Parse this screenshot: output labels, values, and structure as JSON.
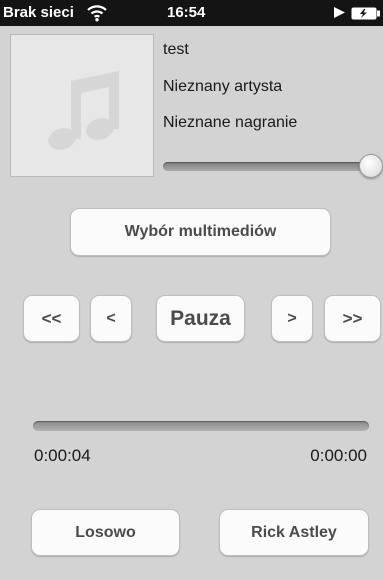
{
  "status_bar": {
    "carrier": "Brak sieci",
    "time": "16:54"
  },
  "now_playing": {
    "title": "test",
    "artist": "Nieznany artysta",
    "album": "Nieznane nagranie",
    "artwork_icon": "music-note-icon",
    "volume_level": 1.0
  },
  "buttons": {
    "media_picker": "Wybór multimediów",
    "rewind": "<<",
    "prev": "<",
    "pause": "Pauza",
    "next": ">",
    "forward": ">>",
    "shuffle": "Losowo",
    "rick_astley": "Rick Astley"
  },
  "progress": {
    "elapsed": "0:00:04",
    "remaining": "0:00:00"
  },
  "colors": {
    "background": "#d3d3d3",
    "status_bar": "#141414",
    "button_face": "#fbfbfb",
    "button_text": "#4b4b4b"
  }
}
